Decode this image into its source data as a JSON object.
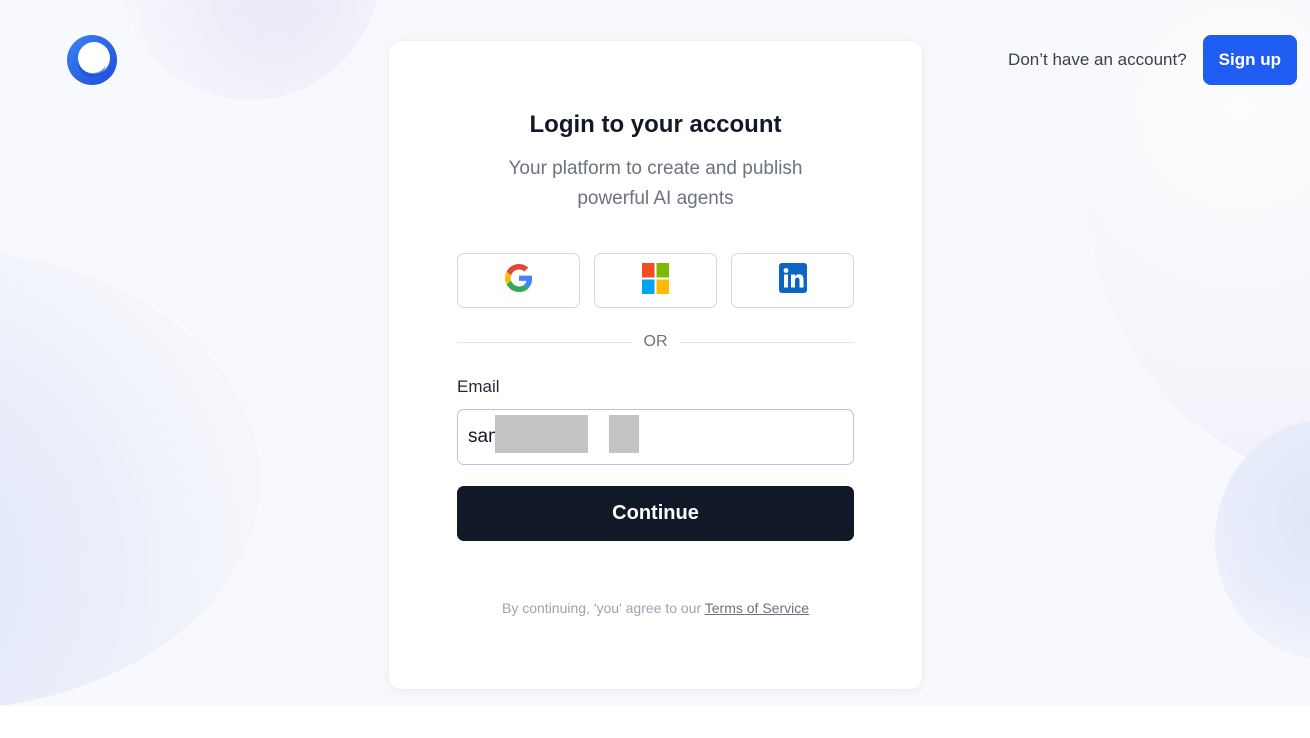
{
  "header": {
    "no_account_text": "Don’t have an account?",
    "signup_label": "Sign up"
  },
  "card": {
    "title": "Login to your account",
    "subtitle": "Your platform to create and publish powerful AI agents"
  },
  "sso": [
    {
      "provider": "Google",
      "icon": "google-icon"
    },
    {
      "provider": "Microsoft",
      "icon": "microsoft-icon"
    },
    {
      "provider": "LinkedIn",
      "icon": "linkedin-icon"
    }
  ],
  "divider": {
    "text": "OR"
  },
  "form": {
    "email_label": "Email",
    "email_value": "sam@k.com",
    "continue_label": "Continue"
  },
  "terms": {
    "prefix": "By continuing, 'you' agree to our ",
    "link_text": "Terms of Service"
  },
  "colors": {
    "primary": "#1e5cf2",
    "dark_button": "#111827",
    "background": "#f8f9fc"
  }
}
